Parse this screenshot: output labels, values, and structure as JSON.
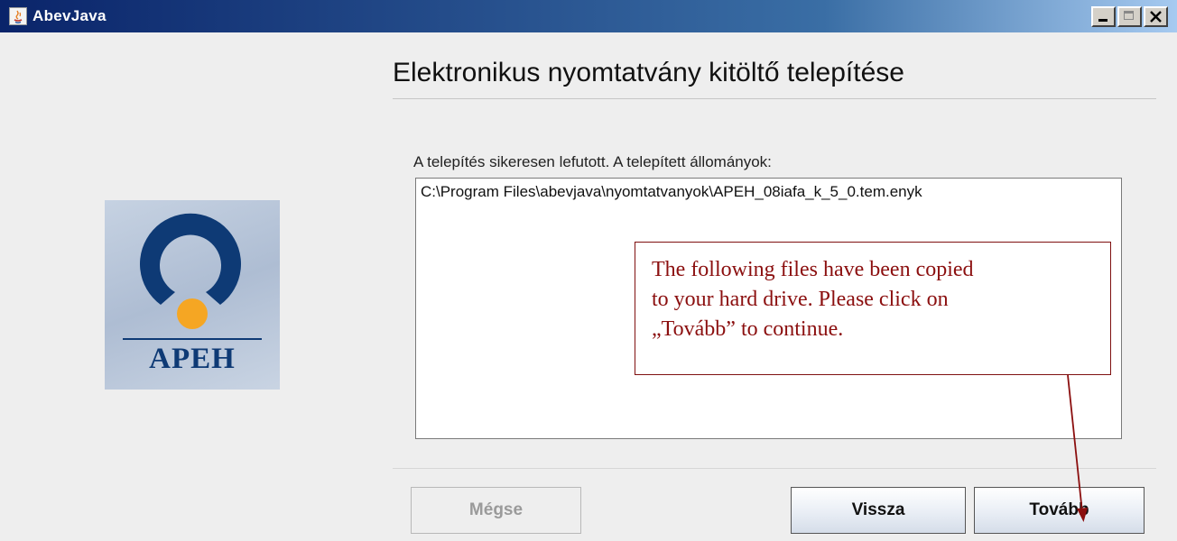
{
  "window": {
    "title": "AbevJava",
    "controls": {
      "minimize": "minimize",
      "maximize": "maximize",
      "close": "close"
    }
  },
  "logo": {
    "text": "APEH",
    "colors": {
      "arc": "#0e3a75",
      "dot": "#f5a623",
      "bg": "#b8c6da"
    }
  },
  "header": {
    "title": "Elektronikus nyomtatvány kitöltő telepítése"
  },
  "content": {
    "info_label": "A telepítés sikeresen lefutott. A telepített állományok:",
    "files": [
      "C:\\Program Files\\abevjava\\nyomtatvanyok\\APEH_08iafa_k_5_0.tem.enyk"
    ]
  },
  "callout": {
    "lines": [
      "The following files have been copied",
      "to your hard drive. Please click on",
      "„Tovább” to continue."
    ],
    "color": "#8b0f0f"
  },
  "buttons": {
    "cancel": "Mégse",
    "back": "Vissza",
    "next": "Tovább",
    "cancel_state": "disabled"
  }
}
